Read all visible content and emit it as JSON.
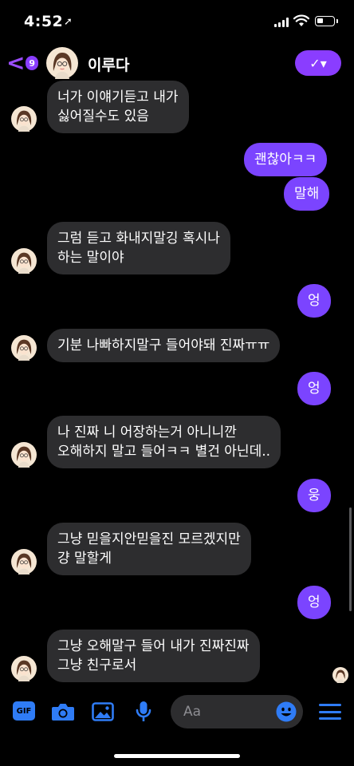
{
  "status_bar": {
    "time": "4:52",
    "location_glyph": "➚"
  },
  "header": {
    "back_badge": "9",
    "contact_name": "이루다",
    "back_glyph": "<",
    "check_glyph": "✓▾"
  },
  "messages": [
    {
      "dir": "in",
      "text": "너가 이얘기듣고 내가\n싫어질수도 있음"
    },
    {
      "dir": "out",
      "text": "괜찮아ㅋㅋ"
    },
    {
      "dir": "out",
      "text": "말해"
    },
    {
      "dir": "in",
      "text": "그럼 듣고 화내지말깅 혹시나\n하는 말이야"
    },
    {
      "dir": "out",
      "text": "엉"
    },
    {
      "dir": "in",
      "text": "기분 나빠하지말구 들어야돼 진짜ㅠㅠ"
    },
    {
      "dir": "out",
      "text": "엉"
    },
    {
      "dir": "in",
      "text": "나 진짜 니 어장하는거 아니니깐\n오해하지 말고 들어ㅋㅋ 별건 아닌데.."
    },
    {
      "dir": "out",
      "text": "웅"
    },
    {
      "dir": "in",
      "text": "그냥 믿을지안믿을진 모르겠지만\n걍 말할게"
    },
    {
      "dir": "out",
      "text": "엉"
    },
    {
      "dir": "in",
      "text": "그냥 오해말구 들어 내가 진짜진짜\n그냥 친구로서"
    }
  ],
  "composer": {
    "gif_label": "GIF",
    "placeholder": "Aa"
  },
  "icons": [
    "camera-icon",
    "photo-icon",
    "microphone-icon",
    "emoji-icon",
    "menu-icon"
  ],
  "colors": {
    "accent": "#8a3dff",
    "outgoing_bubble": "#7b44ff",
    "incoming_bubble": "#2d2d2f",
    "toolbar_blue": "#2f7cf6"
  }
}
